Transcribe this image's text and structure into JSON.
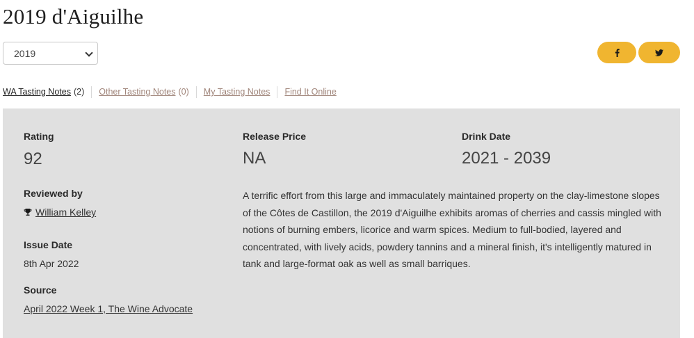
{
  "page": {
    "title": "2019 d'Aiguilhe"
  },
  "vintage_select": {
    "selected": "2019"
  },
  "share": {
    "facebook_icon": "facebook-icon",
    "twitter_icon": "twitter-icon",
    "color": "#f0b530"
  },
  "tabs": [
    {
      "label": "WA Tasting Notes",
      "count": "(2)",
      "active": true
    },
    {
      "label": "Other Tasting Notes",
      "count": "(0)",
      "active": false
    },
    {
      "label": "My Tasting Notes",
      "count": "",
      "active": false
    },
    {
      "label": "Find It Online",
      "count": "",
      "active": false
    }
  ],
  "review": {
    "rating_label": "Rating",
    "rating": "92",
    "release_price_label": "Release Price",
    "release_price": "NA",
    "drink_date_label": "Drink Date",
    "drink_date": "2021 - 2039",
    "reviewed_by_label": "Reviewed by",
    "reviewer": "William Kelley",
    "issue_date_label": "Issue Date",
    "issue_date": "8th Apr 2022",
    "source_label": "Source",
    "source": "April 2022 Week 1, The Wine Advocate",
    "note": "A terrific effort from this large and immaculately maintained property on the clay-limestone slopes of the Côtes de Castillon, the 2019 d'Aiguilhe exhibits aromas of cherries and cassis mingled with notions of burning embers, licorice and warm spices. Medium to full-bodied, layered and concentrated, with lively acids, powdery tannins and a mineral finish, it's intelligently matured in tank and large-format oak as well as small barriques."
  }
}
